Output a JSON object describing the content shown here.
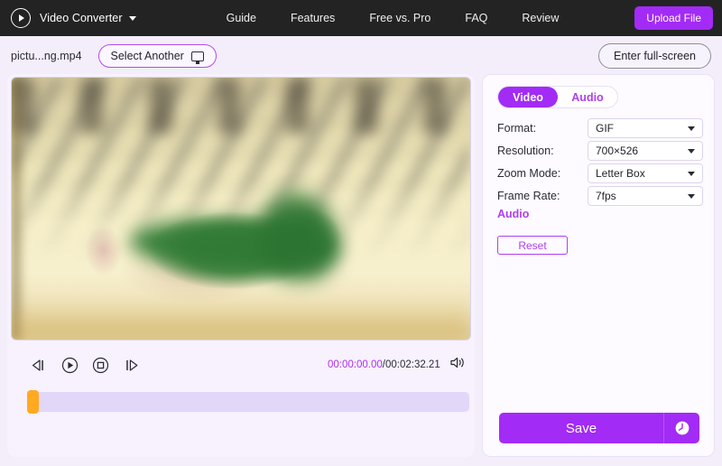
{
  "nav": {
    "logo_icon": "play-circle-icon",
    "brand": "Video Converter",
    "brand_caret_icon": "chevron-down-icon",
    "links": [
      {
        "label": "Guide"
      },
      {
        "label": "Features"
      },
      {
        "label": "Free vs. Pro"
      },
      {
        "label": "FAQ"
      },
      {
        "label": "Review"
      }
    ],
    "upload_label": "Upload File",
    "accent": "#a22bf5",
    "background": "#232323"
  },
  "filebar": {
    "filename": "pictu...ng.mp4",
    "select_another_label": "Select Another",
    "select_another_icon": "monitor-icon",
    "fullscreen_label": "Enter full-screen"
  },
  "player": {
    "controls": [
      {
        "name": "previous-frame",
        "icon": "step-backward-icon"
      },
      {
        "name": "play",
        "icon": "play-circle-icon"
      },
      {
        "name": "stop",
        "icon": "stop-circle-icon"
      },
      {
        "name": "next-frame",
        "icon": "step-forward-icon"
      }
    ],
    "current_time": "00:00:00.00",
    "separator": "/",
    "total_time": "00:02:32.21",
    "volume_icon": "speaker-icon",
    "current_time_color": "#b12df0",
    "trim_handle_color": "#ffaa21",
    "timeline_track_color": "#e2d7f8"
  },
  "settings": {
    "tabs": [
      {
        "label": "Video",
        "active": true
      },
      {
        "label": "Audio",
        "active": false
      }
    ],
    "rows": [
      {
        "label": "Format:",
        "value": "GIF"
      },
      {
        "label": "Resolution:",
        "value": "700×526"
      },
      {
        "label": "Zoom Mode:",
        "value": "Letter Box"
      },
      {
        "label": "Frame Rate:",
        "value": "7fps"
      }
    ],
    "audio_heading": "Audio",
    "reset_label": "Reset",
    "save_label": "Save",
    "save_history_icon": "clock-icon",
    "accent": "#a22bf5"
  }
}
